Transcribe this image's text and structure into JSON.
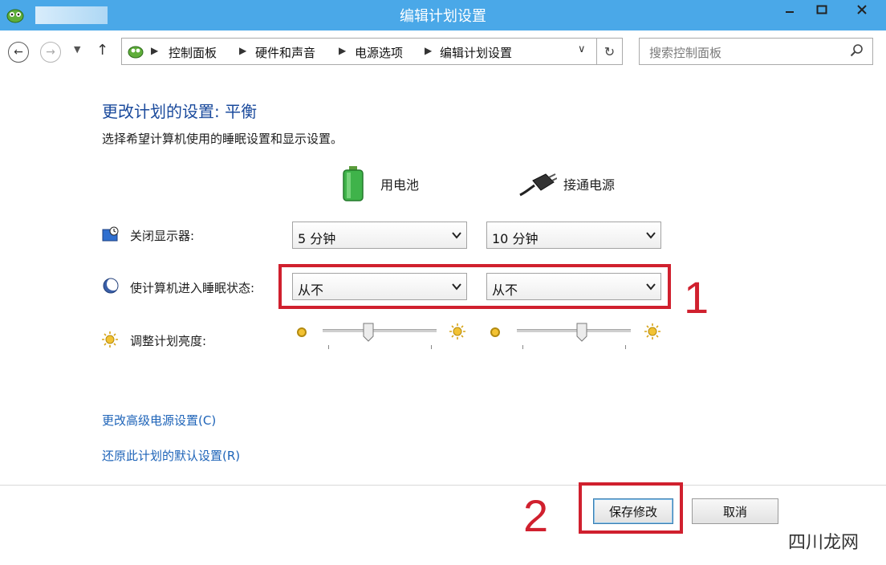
{
  "window": {
    "title": "编辑计划设置",
    "controls": {
      "minimize": "minimize-icon",
      "maximize": "maximize-icon",
      "close": "close-icon"
    }
  },
  "nav": {
    "back": "back-arrow-icon",
    "forward": "forward-arrow-icon",
    "up": "↑",
    "breadcrumb": [
      "控制面板",
      "硬件和声音",
      "电源选项",
      "编辑计划设置"
    ],
    "search_placeholder": "搜索控制面板"
  },
  "main": {
    "heading": "更改计划的设置: 平衡",
    "subtext": "选择希望计算机使用的睡眠设置和显示设置。",
    "columns": {
      "battery": "用电池",
      "plugged": "接通电源"
    },
    "rows": {
      "display": {
        "label": "关闭显示器:",
        "battery_value": "5 分钟",
        "plugged_value": "10 分钟"
      },
      "sleep": {
        "label": "使计算机进入睡眠状态:",
        "battery_value": "从不",
        "plugged_value": "从不"
      },
      "brightness": {
        "label": "调整计划亮度:",
        "battery_level": 0.4,
        "plugged_level": 0.57
      }
    },
    "links": {
      "advanced": "更改高级电源设置(C)",
      "restore": "还原此计划的默认设置(R)"
    },
    "annotations": {
      "one": "1",
      "two": "2"
    }
  },
  "footer": {
    "save": "保存修改",
    "cancel": "取消"
  },
  "watermark": "四川龙网",
  "colors": {
    "titlebar": "#4aa8e8",
    "heading": "#1a4a9c",
    "link": "#1d63b8",
    "annotation": "#d0202e"
  }
}
